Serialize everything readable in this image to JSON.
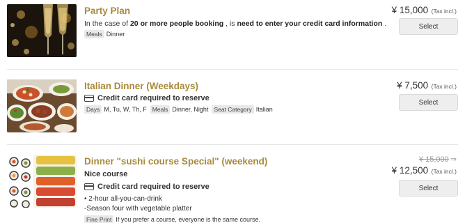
{
  "plans": [
    {
      "title": "Party Plan",
      "desc_prefix": "In the case of ",
      "desc_bold1": "20 or more people booking",
      "desc_mid": " , is ",
      "desc_bold2": "need to enter your credit card information",
      "desc_suffix": " .",
      "tags": [
        {
          "label": "Meals",
          "value": "Dinner"
        }
      ],
      "price": "¥ 15,000",
      "tax": "(Tax incl.)",
      "select_label": "Select"
    },
    {
      "title": "Italian Dinner (Weekdays)",
      "card_text": "Credit card required to reserve",
      "tags": [
        {
          "label": "Days",
          "value": "M, Tu, W, Th, F"
        },
        {
          "label": "Meals",
          "value": "Dinner, Night"
        },
        {
          "label": "Seat Category",
          "value": "Italian"
        }
      ],
      "price": "¥ 7,500",
      "tax": "(Tax incl.)",
      "select_label": "Select"
    },
    {
      "title": "Dinner \"sushi course Special\" (weekend)",
      "subtitle": "Nice course",
      "card_text": "Credit card required to reserve",
      "bullets": [
        "• 2-hour all-you-can-drink",
        "-Season four with vegetable platter"
      ],
      "tags": [
        {
          "label": "Fine Print",
          "value": "If you prefer a course, everyone is the same course."
        }
      ],
      "old_price": "¥ 15,000",
      "old_arrow": "⇒",
      "price": "¥ 12,500",
      "tax": "(Tax incl.)",
      "select_label": "Select"
    }
  ]
}
